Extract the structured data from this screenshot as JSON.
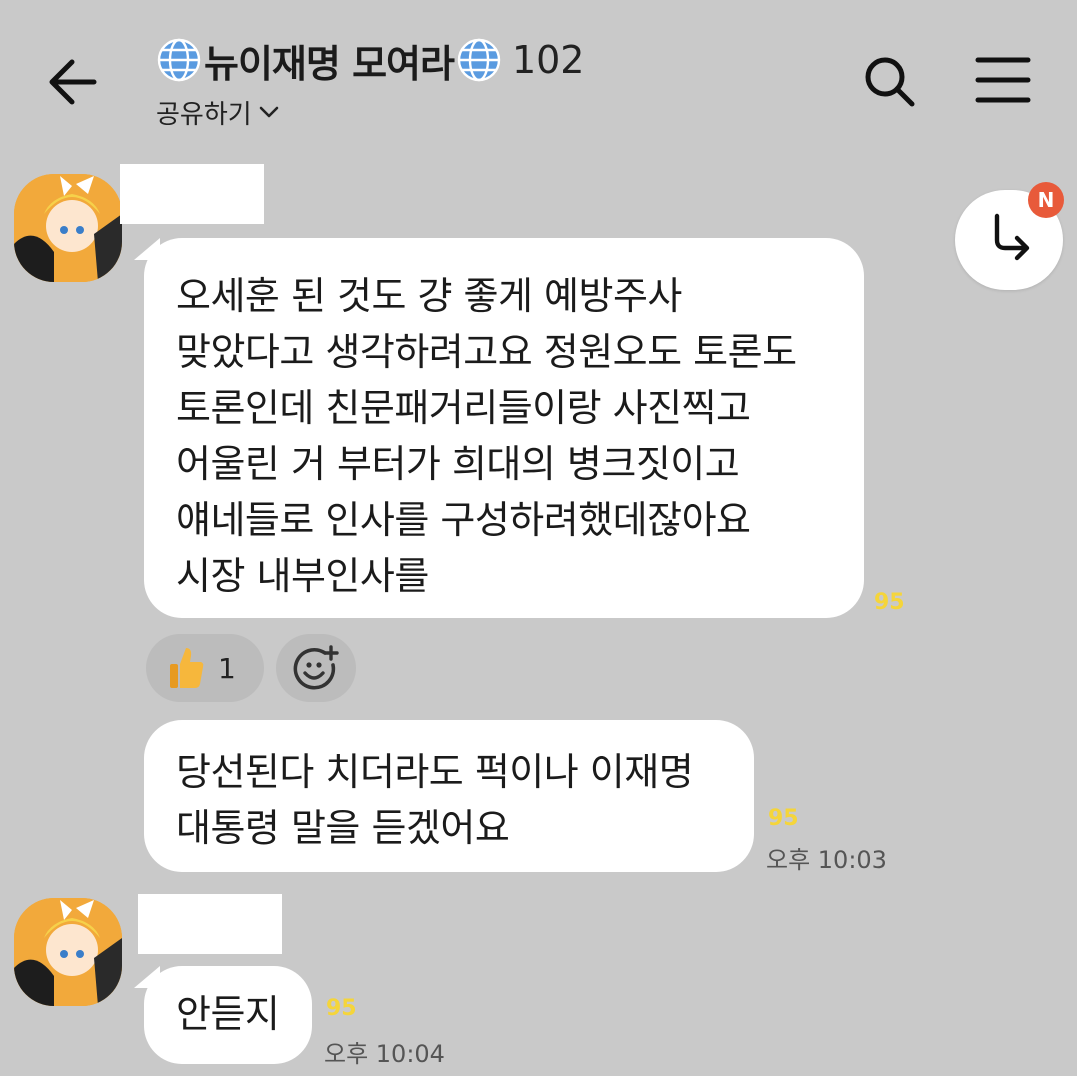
{
  "header": {
    "title": "뉴이재명 모여라",
    "member_count": "102",
    "share_label": "공유하기",
    "icons": {
      "back": "arrow-left-icon",
      "globe": "globe-icon",
      "search": "search-icon",
      "menu": "hamburger-menu-icon",
      "chevron": "chevron-down-icon"
    }
  },
  "reply_button": {
    "icon": "reply-arrow-icon",
    "badge": "N"
  },
  "messages": [
    {
      "lines": [
        "오세훈 된 것도 걍 좋게 예방주사",
        "맞았다고 생각하려고요 정원오도 토론도",
        "토론인데 친문패거리들이랑 사진찍고",
        "어울린 거 부터가 희대의 병크짓이고",
        "얘네들로 인사를 구성하려했데잖아요",
        "시장 내부인사를"
      ],
      "unread": "95",
      "reactions": [
        {
          "icon": "thumbs-up-icon",
          "count": "1"
        }
      ],
      "add_reaction_icon": "add-emoji-icon"
    },
    {
      "lines": [
        "당선된다 치더라도 퍽이나 이재명",
        "대통령 말을 듣겠어요"
      ],
      "unread": "95",
      "time": "오후 10:03"
    },
    {
      "lines": [
        "안듣지"
      ],
      "unread": "95",
      "time": "오후 10:04"
    }
  ],
  "colors": {
    "background": "#c9c9c9",
    "bubble": "#ffffff",
    "unread": "#f5d53a",
    "badge": "#e85a3a"
  }
}
